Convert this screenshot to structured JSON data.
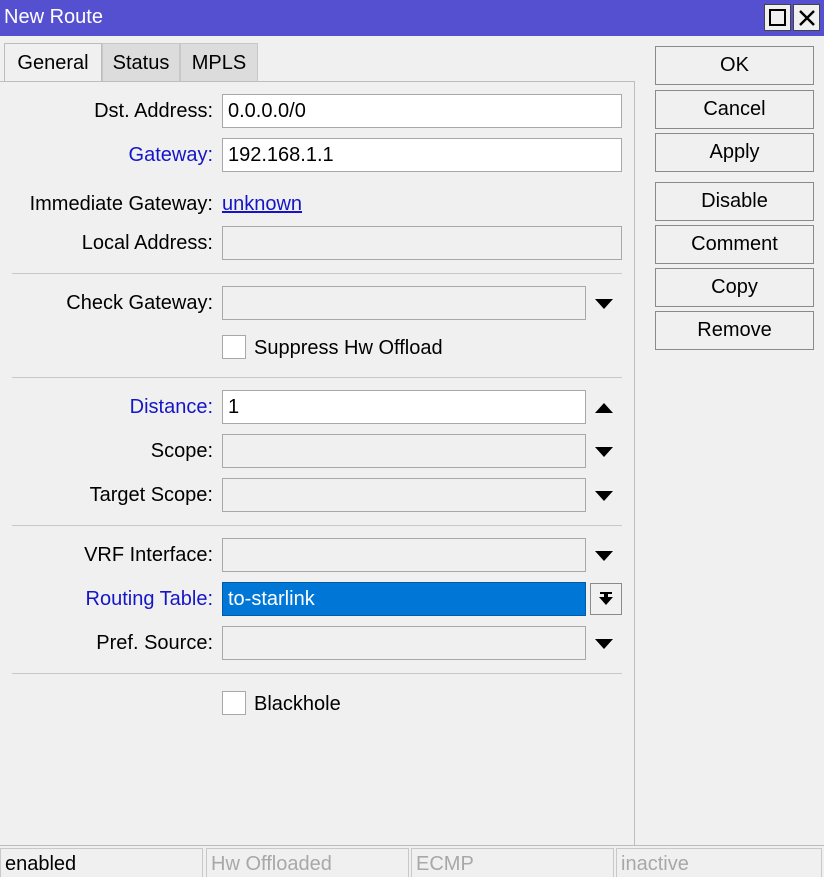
{
  "window": {
    "title": "New Route"
  },
  "tabs": [
    {
      "label": "General",
      "active": true
    },
    {
      "label": "Status",
      "active": false
    },
    {
      "label": "MPLS",
      "active": false
    }
  ],
  "form": {
    "dst_address": {
      "label": "Dst. Address:",
      "value": "0.0.0.0/0"
    },
    "gateway": {
      "label": "Gateway:",
      "value": "192.168.1.1"
    },
    "immediate_gateway": {
      "label": "Immediate Gateway:",
      "value": "unknown"
    },
    "local_address": {
      "label": "Local Address:",
      "value": ""
    },
    "check_gateway": {
      "label": "Check Gateway:",
      "value": ""
    },
    "suppress_hw_offload": {
      "label": "Suppress Hw Offload",
      "checked": false
    },
    "distance": {
      "label": "Distance:",
      "value": "1"
    },
    "scope": {
      "label": "Scope:",
      "value": ""
    },
    "target_scope": {
      "label": "Target Scope:",
      "value": ""
    },
    "vrf_interface": {
      "label": "VRF Interface:",
      "value": ""
    },
    "routing_table": {
      "label": "Routing Table:",
      "value": "to-starlink"
    },
    "pref_source": {
      "label": "Pref. Source:",
      "value": ""
    },
    "blackhole": {
      "label": "Blackhole",
      "checked": false
    }
  },
  "buttons": {
    "ok": "OK",
    "cancel": "Cancel",
    "apply": "Apply",
    "disable": "Disable",
    "comment": "Comment",
    "copy": "Copy",
    "remove": "Remove"
  },
  "status_bar": {
    "state": "enabled",
    "hw_offloaded": "Hw Offloaded",
    "ecmp": "ECMP",
    "active": "inactive"
  },
  "colors": {
    "title_bar": "#5550d0",
    "required_label": "#1515c8",
    "selection": "#0077d6"
  },
  "icons": {
    "maximize": "maximize-icon",
    "close": "close-icon",
    "dropdown": "dropdown-arrow-icon",
    "spin_up": "spin-up-icon",
    "dropdown_alt": "dropdown-menu-icon"
  }
}
